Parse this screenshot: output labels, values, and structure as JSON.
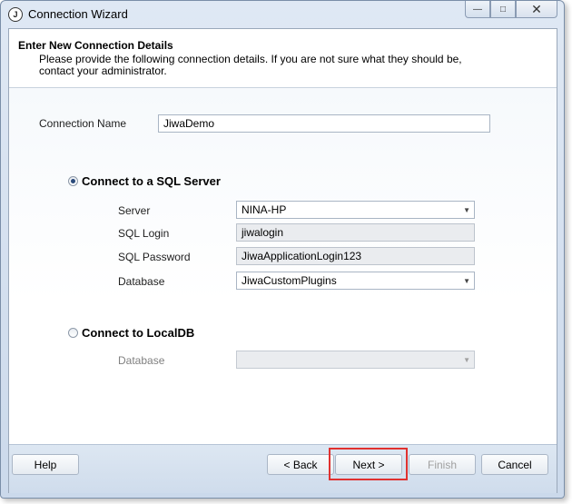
{
  "window": {
    "title": "Connection Wizard",
    "app_icon_glyph": "J",
    "controls": {
      "minimize": "—",
      "maximize": "□",
      "close": "✕"
    }
  },
  "header": {
    "title": "Enter New Connection Details",
    "description": "Please provide the following connection details. If you are not sure what they should be, contact your administrator."
  },
  "form": {
    "connection_name_label": "Connection Name",
    "connection_name_value": "JiwaDemo",
    "sql_server": {
      "radio_label": "Connect to a SQL Server",
      "selected": true,
      "server_label": "Server",
      "server_value": "NINA-HP",
      "login_label": "SQL Login",
      "login_value": "jiwalogin",
      "password_label": "SQL Password",
      "password_value": "JiwaApplicationLogin123",
      "database_label": "Database",
      "database_value": "JiwaCustomPlugins"
    },
    "localdb": {
      "radio_label": "Connect to LocalDB",
      "selected": false,
      "database_label": "Database",
      "database_value": ""
    }
  },
  "buttons": {
    "help": "Help",
    "back": "< Back",
    "next": "Next >",
    "finish": "Finish",
    "cancel": "Cancel"
  },
  "icons": {
    "app": "jiwa-logo-icon",
    "dropdown": "chevron-down-icon"
  },
  "colors": {
    "highlight": "#e0312f",
    "radio_selected": "#2a4a7a",
    "disabled_text": "#a0a0a0"
  }
}
